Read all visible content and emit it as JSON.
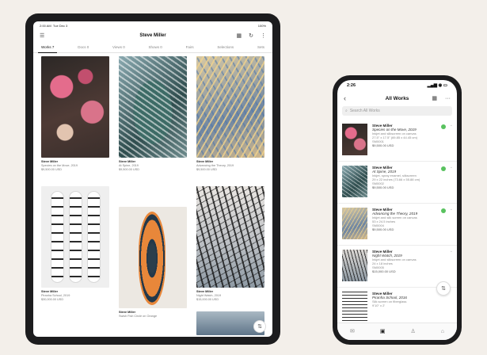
{
  "tablet": {
    "status": {
      "time": "2:00 AM",
      "date": "Tue Dec 3",
      "battery": "100%"
    },
    "nav": {
      "title": "Steve Miller",
      "menu_icon": "hamburger-icon",
      "grid_icon": "grid-icon",
      "refresh_icon": "refresh-icon",
      "more_icon": "more-vertical-icon"
    },
    "tabs": [
      {
        "label": "Works 7",
        "active": true
      },
      {
        "label": "Docs 0"
      },
      {
        "label": "Views 0"
      },
      {
        "label": "Shows 0"
      },
      {
        "label": "Fairs"
      },
      {
        "label": "Selections"
      },
      {
        "label": "Sets"
      }
    ],
    "works": [
      {
        "artist": "Steve Miller",
        "title": "Species on the Move, 2019",
        "price": "$9,500.00 USD"
      },
      {
        "artist": "Steve Miller",
        "title": "At Spine, 2019",
        "price": "$9,500.00 USD"
      },
      {
        "artist": "Steve Miller",
        "title": "Advancing the Theory, 2019",
        "price": "$9,500.00 USD"
      },
      {
        "artist": "Steve Miller",
        "title": "Piranha School, 2019",
        "price": "$30,000.00 USD"
      },
      {
        "artist": "Steve Miller",
        "title": "Swish Fish Circle on Orange",
        "price": ""
      },
      {
        "artist": "Steve Miller",
        "title": "Night Watch, 2019",
        "price": "$15,000.00 USD"
      }
    ],
    "filter_icon": "sliders-icon"
  },
  "phone": {
    "status": {
      "time": "2:26"
    },
    "nav": {
      "title": "All Works",
      "back_icon": "chevron-left-icon",
      "grid_icon": "grid-icon",
      "more_icon": "more-horizontal-icon"
    },
    "search": {
      "placeholder": "Search All Works"
    },
    "items": [
      {
        "artist": "Steve Miller",
        "title": "Species on the Move, 2019",
        "medium": "Inkjet and silkscreen on canvas",
        "dims": "27.5\" x 17.5\" (69.85 x 44.45 cm)",
        "id": "SM0001",
        "price": "$9,500.00 USD"
      },
      {
        "artist": "Steve Miller",
        "title": "At Spine, 2019",
        "medium": "Inkjet, spray enamel, silkscreen",
        "dims": "29 x 22 inches (73.66 x 55.88 cm)",
        "id": "SM0002",
        "price": "$9,500.00 USD"
      },
      {
        "artist": "Steve Miller",
        "title": "Advancing the Theory, 2019",
        "medium": "Inkjet and silk screen on canvas",
        "dims": "53 x 24.5 inches",
        "id": "SM0004",
        "price": "$9,500.00 USD"
      },
      {
        "artist": "Steve Miller",
        "title": "Night Watch, 2019",
        "medium": "Inkjet and silkscreen on canvas",
        "dims": "24 x 18 inches",
        "id": "SM0005",
        "price": "$15,000.00 USD"
      },
      {
        "artist": "Steve Miller",
        "title": "Piranha School, 2016",
        "medium": "Silk screen on fiberglass",
        "dims": "9'10\" x 2'",
        "id": "",
        "price": ""
      }
    ],
    "tabbar": [
      {
        "name": "inbox-icon",
        "glyph": "✉"
      },
      {
        "name": "image-icon",
        "glyph": "▣",
        "active": true
      },
      {
        "name": "contacts-icon",
        "glyph": "♙"
      },
      {
        "name": "home-icon",
        "glyph": "⌂"
      }
    ],
    "filter_icon": "sliders-icon"
  }
}
